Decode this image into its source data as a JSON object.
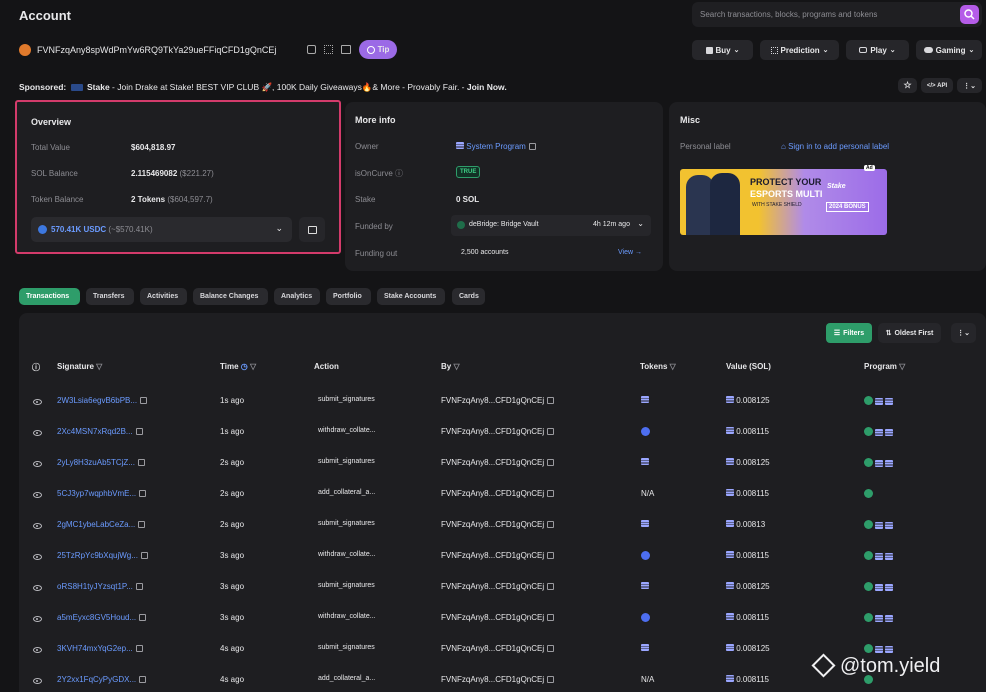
{
  "header": {
    "title": "Account",
    "search_placeholder": "Search transactions, blocks, programs and tokens"
  },
  "account": {
    "address": "FVNFzqAny8spWdPmYw6RQ9TkYa29ueFFiqCFD1gQnCEj",
    "tip_label": "Tip"
  },
  "nav": {
    "buy": "Buy",
    "prediction": "Prediction",
    "play": "Play",
    "gaming": "Gaming",
    "api": "API"
  },
  "sponsored": {
    "label": "Sponsored:",
    "brand": "Stake",
    "text_a": " - Join Drake at Stake! BEST VIP CLUB 🚀, 100K Daily Giveaways🔥& More - Provably Fair. - ",
    "cta": "Join Now."
  },
  "overview": {
    "title": "Overview",
    "total_value_label": "Total Value",
    "total_value": "$604,818.97",
    "sol_balance_label": "SOL Balance",
    "sol_balance": "2.115469082",
    "sol_balance_usd": "($221.27)",
    "token_balance_label": "Token Balance",
    "token_balance": "2 Tokens",
    "token_balance_usd": "($604,597.7)",
    "selected_token": "570.41K USDC",
    "selected_token_usd": "(~$570.41K)"
  },
  "more_info": {
    "title": "More info",
    "owner_label": "Owner",
    "owner_value": "System Program",
    "is_on_curve_label": "isOnCurve",
    "is_on_curve_value": "TRUE",
    "stake_label": "Stake",
    "stake_value": "0 SOL",
    "funded_by_label": "Funded by",
    "funded_by_value": "deBridge: Bridge Vault",
    "funded_by_time": "4h 12m ago",
    "funding_out_label": "Funding out",
    "funding_out_value": "2,500 accounts",
    "view_label": "View →"
  },
  "misc": {
    "title": "Misc",
    "personal_label": "Personal label",
    "sign_in_text": "Sign in to add personal label",
    "ad_badge": "Ad",
    "ad_line1": "PROTECT YOUR",
    "ad_line2": "ESPORTS MULTI",
    "ad_line3": "WITH STAKE SHIELD",
    "ad_brand": "Stake",
    "ad_bonus": "2024 BONUS"
  },
  "tabs": [
    "Transactions",
    "Transfers",
    "Activities",
    "Balance Changes",
    "Analytics",
    "Portfolio",
    "Stake Accounts",
    "Cards"
  ],
  "table_controls": {
    "filters": "Filters",
    "sort": "Oldest First"
  },
  "columns": {
    "signature": "Signature",
    "time": "Time",
    "action": "Action",
    "by": "By",
    "tokens": "Tokens",
    "value": "Value (SOL)",
    "program": "Program"
  },
  "rows": [
    {
      "signature": "2W3Lsia6egvB6bPB...",
      "time": "1s ago",
      "action": "submit_signatures",
      "by": "FVNFzqAny8...CFD1gQnCEj",
      "token": "sq",
      "value": "0.008125",
      "program": "3"
    },
    {
      "signature": "2Xc4MSN7xRqd2B...",
      "time": "1s ago",
      "action": "withdraw_collate...",
      "by": "FVNFzqAny8...CFD1gQnCEj",
      "token": "circ",
      "value": "0.008115",
      "program": "3"
    },
    {
      "signature": "2yLy8H3zuAb5TCjZ...",
      "time": "2s ago",
      "action": "submit_signatures",
      "by": "FVNFzqAny8...CFD1gQnCEj",
      "token": "sq",
      "value": "0.008125",
      "program": "3"
    },
    {
      "signature": "5CJ3yp7wqphbVmE...",
      "time": "2s ago",
      "action": "add_collateral_a...",
      "by": "FVNFzqAny8...CFD1gQnCEj",
      "token": "N/A",
      "value": "0.008115",
      "program": "1"
    },
    {
      "signature": "2gMC1ybeLabCeZa...",
      "time": "2s ago",
      "action": "submit_signatures",
      "by": "FVNFzqAny8...CFD1gQnCEj",
      "token": "sq",
      "value": "0.00813",
      "program": "3"
    },
    {
      "signature": "25TzRpYc9bXqujWg...",
      "time": "3s ago",
      "action": "withdraw_collate...",
      "by": "FVNFzqAny8...CFD1gQnCEj",
      "token": "circ",
      "value": "0.008115",
      "program": "3"
    },
    {
      "signature": "oRS8H1tyJYzsqt1P...",
      "time": "3s ago",
      "action": "submit_signatures",
      "by": "FVNFzqAny8...CFD1gQnCEj",
      "token": "sq",
      "value": "0.008125",
      "program": "3"
    },
    {
      "signature": "a5mEyxc8GV5Houd...",
      "time": "3s ago",
      "action": "withdraw_collate...",
      "by": "FVNFzqAny8...CFD1gQnCEj",
      "token": "circ",
      "value": "0.008115",
      "program": "3"
    },
    {
      "signature": "3KVH74mxYqG2ep...",
      "time": "4s ago",
      "action": "submit_signatures",
      "by": "FVNFzqAny8...CFD1gQnCEj",
      "token": "sq",
      "value": "0.008125",
      "program": "3"
    },
    {
      "signature": "2Y2xx1FqCyPyGDX...",
      "time": "4s ago",
      "action": "add_collateral_a...",
      "by": "FVNFzqAny8...CFD1gQnCEj",
      "token": "N/A",
      "value": "0.008115",
      "program": "1"
    }
  ],
  "watermark": "@tom.yield",
  "colors": {
    "accent_purple": "#b55ce8",
    "highlight_border": "#d33b6b",
    "link_blue": "#6b9bff",
    "green": "#2e9d6a"
  }
}
